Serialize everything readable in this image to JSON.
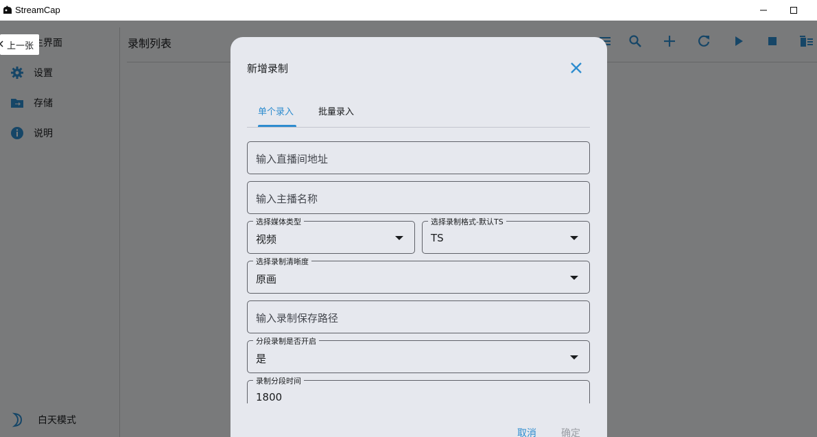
{
  "window": {
    "title": "StreamCap"
  },
  "tooltip": {
    "text": "上一张"
  },
  "sidebar": {
    "items": [
      {
        "label": "主界面",
        "icon": "home-icon"
      },
      {
        "label": "设置",
        "icon": "gear-icon"
      },
      {
        "label": "存储",
        "icon": "folder-icon"
      },
      {
        "label": "说明",
        "icon": "info-icon"
      }
    ],
    "theme_toggle": {
      "label": "白天模式",
      "icon": "moon-icon"
    }
  },
  "main": {
    "title": "录制列表",
    "toolbar": [
      "filter-icon",
      "search-icon",
      "add-icon",
      "refresh-icon",
      "play-icon",
      "stop-icon",
      "delete-icon"
    ]
  },
  "dialog": {
    "title": "新增录制",
    "tabs": [
      {
        "label": "单个录入",
        "active": true
      },
      {
        "label": "批量录入",
        "active": false
      }
    ],
    "fields": {
      "url": {
        "placeholder": "输入直播间地址"
      },
      "streamer": {
        "placeholder": "输入主播名称"
      },
      "media_type": {
        "label": "选择媒体类型",
        "value": "视频"
      },
      "format": {
        "label": "选择录制格式-默认TS",
        "value": "TS"
      },
      "quality": {
        "label": "选择录制清晰度",
        "value": "原画"
      },
      "save_path": {
        "placeholder": "输入录制保存路径"
      },
      "segment_enabled": {
        "label": "分段录制是否开启",
        "value": "是"
      },
      "segment_time": {
        "label": "录制分段时间",
        "value": "1800"
      }
    },
    "actions": {
      "cancel": "取消",
      "confirm": "确定"
    }
  },
  "colors": {
    "accent": "#2d8ccf",
    "scrim": "rgba(0,0,0,0.5)",
    "dialog_bg": "#e6e8ee"
  }
}
